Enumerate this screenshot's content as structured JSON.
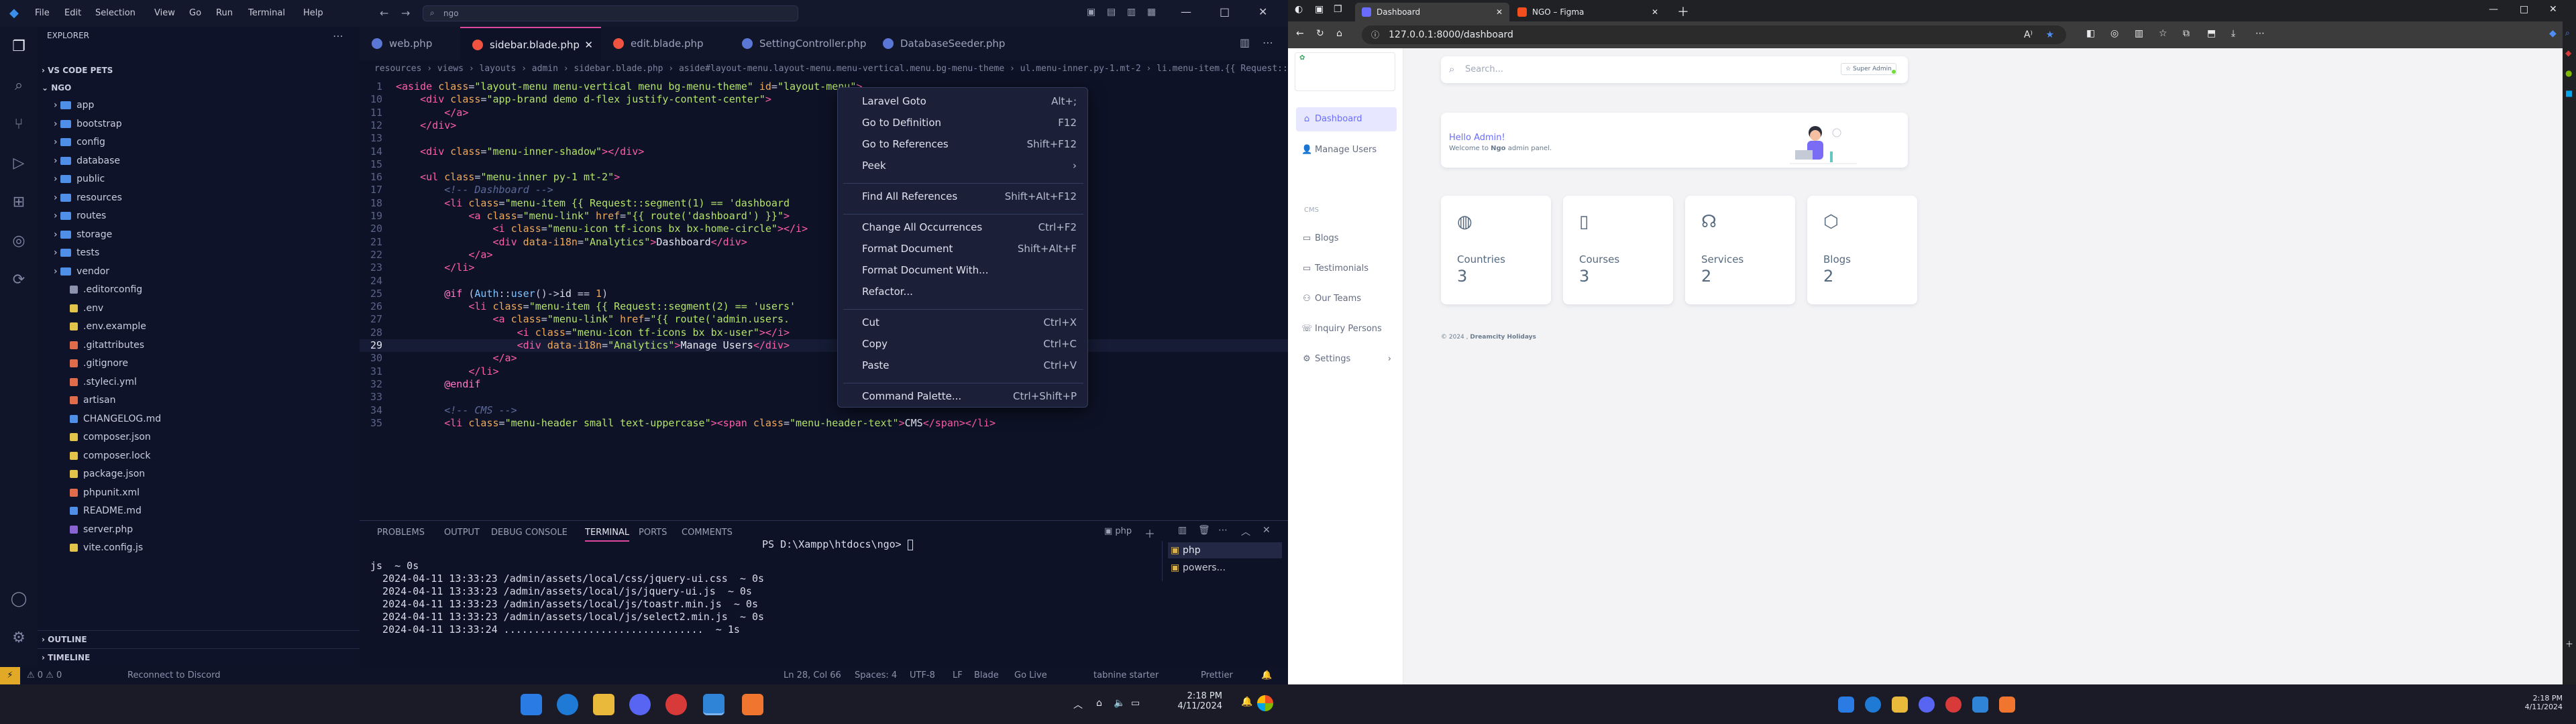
{
  "vscode": {
    "menu": [
      "File",
      "Edit",
      "Selection",
      "View",
      "Go",
      "Run",
      "Terminal",
      "Help"
    ],
    "search": "ngo",
    "explorer": {
      "header": "VS CODE PETS",
      "root": "NGO",
      "folders": [
        "app",
        "bootstrap",
        "config",
        "database",
        "public",
        "resources",
        "routes",
        "storage",
        "tests",
        "vendor"
      ],
      "files": [
        ".editorconfig",
        ".env",
        ".env.example",
        ".gitattributes",
        ".gitignore",
        ".styleci.yml",
        "artisan",
        "CHANGELOG.md",
        "composer.json",
        "composer.lock",
        "package.json",
        "phpunit.xml",
        "README.md",
        "server.php",
        "vite.config.js"
      ],
      "outline": "OUTLINE",
      "timeline": "TIMELINE"
    },
    "tabs": [
      "web.php",
      "sidebar.blade.php",
      "edit.blade.php",
      "SettingController.php",
      "DatabaseSeeder.php"
    ],
    "active_tab": 1,
    "breadcrumb": "resources › views › layouts › admin › sidebar.blade.php › aside#layout-menu.layout-menu.menu-vertical.menu.bg-menu-theme › ul.menu-inner.py-1.mt-2 › li.menu-item.{{ Request::segment(1) == 'dashboard' ? 'active' : '' }}",
    "code": [
      {
        "n": "1",
        "html": "<span class=tg>&lt;aside</span> <span class=at>class</span>=<span class=st>\"layout-menu menu-vertical menu bg-menu-theme\"</span> <span class=at>id</span>=<span class=st>\"layout-menu\"</span><span class=tg>&gt;</span>"
      },
      {
        "n": "10",
        "html": "    <span class=tg>&lt;div</span> <span class=at>class</span>=<span class=st>\"app-brand demo d-flex justify-content-center\"</span><span class=tg>&gt;</span>"
      },
      {
        "n": "11",
        "html": "        <span class=tg>&lt;/a&gt;</span>"
      },
      {
        "n": "12",
        "html": "    <span class=tg>&lt;/div&gt;</span>"
      },
      {
        "n": "13",
        "html": ""
      },
      {
        "n": "14",
        "html": "    <span class=tg>&lt;div</span> <span class=at>class</span>=<span class=st>\"menu-inner-shadow\"</span><span class=tg>&gt;&lt;/div&gt;</span>"
      },
      {
        "n": "15",
        "html": ""
      },
      {
        "n": "16",
        "html": "    <span class=tg>&lt;ul</span> <span class=at>class</span>=<span class=st>\"menu-inner py-1 mt-2\"</span><span class=tg>&gt;</span>"
      },
      {
        "n": "17",
        "html": "        <span class=cm>&lt;!-- Dashboard --&gt;</span>"
      },
      {
        "n": "18",
        "html": "        <span class=tg>&lt;li</span> <span class=at>class</span>=<span class=st>\"menu-item {{ Request::segment(1) == 'dashboard</span>"
      },
      {
        "n": "19",
        "html": "            <span class=tg>&lt;a</span> <span class=at>class</span>=<span class=st>\"menu-link\"</span> <span class=at>href</span>=<span class=st>\"{{ route('dashboard') }}\"</span><span class=tg>&gt;</span>"
      },
      {
        "n": "20",
        "html": "                <span class=tg>&lt;i</span> <span class=at>class</span>=<span class=st>\"menu-icon tf-icons bx bx-home-circle\"</span><span class=tg>&gt;&lt;/i&gt;</span>"
      },
      {
        "n": "21",
        "html": "                <span class=tg>&lt;div</span> <span class=at>data-i18n</span>=<span class=st>\"Analytics\"</span><span class=tg>&gt;</span><span class=vb>Dashboard</span><span class=tg>&lt;/div&gt;</span>"
      },
      {
        "n": "22",
        "html": "            <span class=tg>&lt;/a&gt;</span>"
      },
      {
        "n": "23",
        "html": "        <span class=tg>&lt;/li&gt;</span>"
      },
      {
        "n": "24",
        "html": ""
      },
      {
        "n": "25",
        "html": "        <span class=kw>@if</span> (<span class=fn>Auth</span>::<span class=fn>user</span>()-&gt;<span class=vb>id</span> == <span class=at>1</span>)"
      },
      {
        "n": "26",
        "html": "            <span class=tg>&lt;li</span> <span class=at>class</span>=<span class=st>\"menu-item {{ Request::segment(2) == 'users'</span>"
      },
      {
        "n": "27",
        "html": "                <span class=tg>&lt;a</span> <span class=at>class</span>=<span class=st>\"menu-link\"</span> <span class=at>href</span>=<span class=st>\"{{ route('admin.users.</span>"
      },
      {
        "n": "28",
        "html": "                    <span class=tg>&lt;i</span> <span class=at>class</span>=<span class=st>\"menu-icon tf-icons bx bx-user\"</span><span class=tg>&gt;&lt;/i&gt;</span>"
      },
      {
        "n": "29",
        "html": "                    <span class=tg>&lt;div</span> <span class=at>data-i18n</span>=<span class=st>\"Analytics\"</span><span class=tg>&gt;</span><span class=vb>Manage Users</span><span class=tg>&lt;/div&gt;</span>",
        "cur": true
      },
      {
        "n": "30",
        "html": "                <span class=tg>&lt;/a&gt;</span>"
      },
      {
        "n": "31",
        "html": "            <span class=tg>&lt;/li&gt;</span>"
      },
      {
        "n": "32",
        "html": "        <span class=kw>@endif</span>"
      },
      {
        "n": "33",
        "html": ""
      },
      {
        "n": "34",
        "html": "        <span class=cm>&lt;!-- CMS --&gt;</span>"
      },
      {
        "n": "35",
        "html": "        <span class=tg>&lt;li</span> <span class=at>class</span>=<span class=st>\"menu-header small text-uppercase\"</span><span class=tg>&gt;&lt;span</span> <span class=at>class</span>=<span class=st>\"menu-header-text\"</span><span class=tg>&gt;</span><span class=vb>CMS</span><span class=tg>&lt;/span&gt;&lt;/li&gt;</span>"
      }
    ],
    "context_menu": [
      {
        "label": "Laravel Goto",
        "key": "Alt+;"
      },
      {
        "label": "Go to Definition",
        "key": "F12"
      },
      {
        "label": "Go to References",
        "key": "Shift+F12"
      },
      {
        "label": "Peek",
        "key": "›"
      },
      {
        "sep": true
      },
      {
        "label": "Find All References",
        "key": "Shift+Alt+F12"
      },
      {
        "sep": true
      },
      {
        "label": "Change All Occurrences",
        "key": "Ctrl+F2"
      },
      {
        "label": "Format Document",
        "key": "Shift+Alt+F"
      },
      {
        "label": "Format Document With...",
        "key": ""
      },
      {
        "label": "Refactor...",
        "key": ""
      },
      {
        "sep": true
      },
      {
        "label": "Cut",
        "key": "Ctrl+X"
      },
      {
        "label": "Copy",
        "key": "Ctrl+C"
      },
      {
        "label": "Paste",
        "key": "Ctrl+V"
      },
      {
        "sep": true
      },
      {
        "label": "Command Palette...",
        "key": "Ctrl+Shift+P"
      }
    ],
    "panel_tabs": [
      "PROBLEMS",
      "OUTPUT",
      "DEBUG CONSOLE",
      "TERMINAL",
      "PORTS",
      "COMMENTS"
    ],
    "panel_active": 3,
    "terminal_lines": [
      "js  ~ 0s",
      "  2024-04-11 13:33:23 /admin/assets/local/css/jquery-ui.css  ~ 0s",
      "  2024-04-11 13:33:23 /admin/assets/local/js/jquery-ui.js  ~ 0s",
      "  2024-04-11 13:33:23 /admin/assets/local/js/toastr.min.js  ~ 0s",
      "  2024-04-11 13:33:23 /admin/assets/local/js/select2.min.js  ~ 0s",
      "  2024-04-11 13:33:24 .................................  ~ 1s"
    ],
    "terminal_prompt": "PS D:\\Xampp\\htdocs\\ngo>",
    "terminals": [
      "php",
      "powers..."
    ],
    "status_left": [
      "⚠ 0  ⚠ 0",
      "Reconnect to Discord"
    ],
    "status_right": [
      "Ln 28, Col 66",
      "Spaces: 4",
      "UTF-8",
      "LF",
      "Blade",
      "Go Live",
      "tabnine starter",
      "Prettier"
    ]
  },
  "taskbar_left": {
    "time": "2:18 PM",
    "date": "4/11/2024"
  },
  "browser": {
    "tabs": [
      "Dashboard",
      "NGO – Figma"
    ],
    "url": "127.0.0.1:8000/dashboard",
    "sidebar": {
      "items": [
        "Dashboard",
        "Manage Users"
      ],
      "section": "CMS",
      "cms_items": [
        "Blogs",
        "Testimonials",
        "Our Teams",
        "Inquiry Persons",
        "Settings"
      ]
    },
    "search_placeholder": "Search...",
    "user_button": "Super Admin",
    "welcome_title": "Hello Admin!",
    "welcome_text_pre": "Welcome to ",
    "welcome_text_bold": "Ngo",
    "welcome_text_post": " admin panel.",
    "stats": [
      {
        "label": "Countries",
        "value": "3",
        "icon": "globe-icon"
      },
      {
        "label": "Courses",
        "value": "3",
        "icon": "book-icon"
      },
      {
        "label": "Services",
        "value": "2",
        "icon": "headset-icon"
      },
      {
        "label": "Blogs",
        "value": "2",
        "icon": "cube-icon"
      }
    ],
    "footer_pre": "© 2024 , ",
    "footer_brand": "Dreamcity Holidays"
  },
  "taskbar_right": {
    "time": "2:18 PM",
    "date": "4/11/2024"
  }
}
